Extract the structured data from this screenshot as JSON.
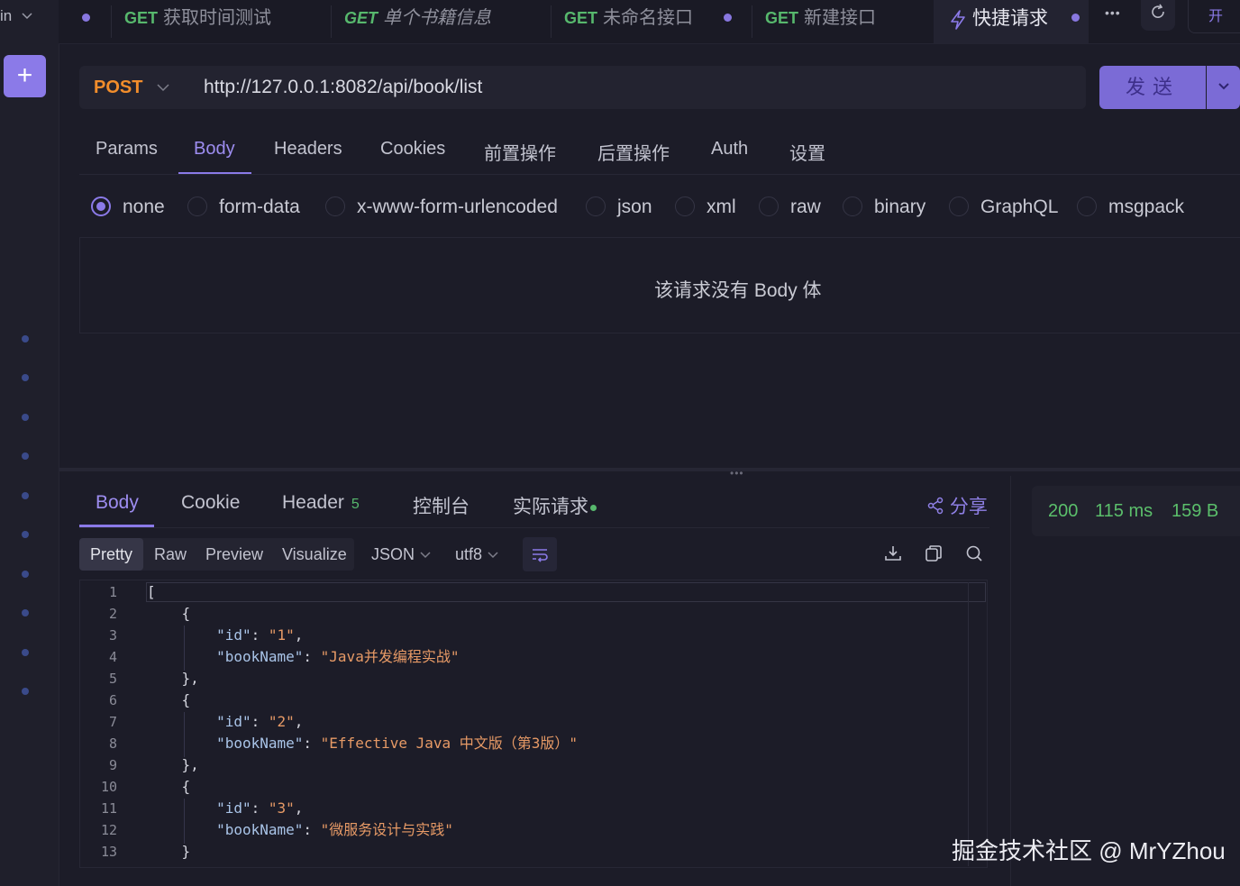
{
  "rail": {
    "top_text": "in",
    "top_chevron": "chevron-down-icon",
    "add_label": "+"
  },
  "tabs": [
    {
      "method": "GET",
      "title": "获取时间测试"
    },
    {
      "method": "GET",
      "title": "单个书籍信息",
      "italic": true
    },
    {
      "method": "GET",
      "title": "未命名接口"
    },
    {
      "method": "GET",
      "title": "新建接口"
    }
  ],
  "active_tab": {
    "icon": "lightning-icon",
    "title": "快捷请求"
  },
  "tabbar_right": {
    "more": "•••",
    "refresh_icon": "refresh-icon",
    "open": "开"
  },
  "request": {
    "method": "POST",
    "url": "http://127.0.0.1:8082/api/book/list",
    "send_label": "发送"
  },
  "request_tabs": [
    "Params",
    "Body",
    "Headers",
    "Cookies",
    "前置操作",
    "后置操作",
    "Auth",
    "设置"
  ],
  "active_request_tab": "Body",
  "body_types": [
    "none",
    "form-data",
    "x-www-form-urlencoded",
    "json",
    "xml",
    "raw",
    "binary",
    "GraphQL",
    "msgpack"
  ],
  "selected_body_type": "none",
  "empty_body_text": "该请求没有 Body 体",
  "response_tabs": {
    "body": "Body",
    "cookie": "Cookie",
    "header": "Header",
    "header_count": "5",
    "console": "控制台",
    "actual": "实际请求"
  },
  "share_label": "分享",
  "status": {
    "code": "200",
    "time": "115 ms",
    "size": "159 B"
  },
  "format": {
    "pretty": "Pretty",
    "raw": "Raw",
    "preview": "Preview",
    "visualize": "Visualize",
    "type": "JSON",
    "encoding": "utf8"
  },
  "code_lines": [
    {
      "n": "1",
      "text": "["
    },
    {
      "n": "2",
      "text": "    {"
    },
    {
      "n": "3",
      "key": "\"id\"",
      "val": "\"1\"",
      "tail": ","
    },
    {
      "n": "4",
      "key": "\"bookName\"",
      "val": "\"Java并发编程实战\"",
      "tail": ""
    },
    {
      "n": "5",
      "text": "    },"
    },
    {
      "n": "6",
      "text": "    {"
    },
    {
      "n": "7",
      "key": "\"id\"",
      "val": "\"2\"",
      "tail": ","
    },
    {
      "n": "8",
      "key": "\"bookName\"",
      "val": "\"Effective Java 中文版（第3版）\"",
      "tail": ""
    },
    {
      "n": "9",
      "text": "    },"
    },
    {
      "n": "10",
      "text": "    {"
    },
    {
      "n": "11",
      "key": "\"id\"",
      "val": "\"3\"",
      "tail": ","
    },
    {
      "n": "12",
      "key": "\"bookName\"",
      "val": "\"微服务设计与实践\"",
      "tail": ""
    },
    {
      "n": "13",
      "text": "    }"
    }
  ],
  "watermark": "掘金技术社区 @ MrYZhou",
  "colors": {
    "accent": "#8b7ae8",
    "get": "#57b86d",
    "post": "#f28d2b",
    "status_ok": "#5bbf6b",
    "string": "#e79a66"
  }
}
